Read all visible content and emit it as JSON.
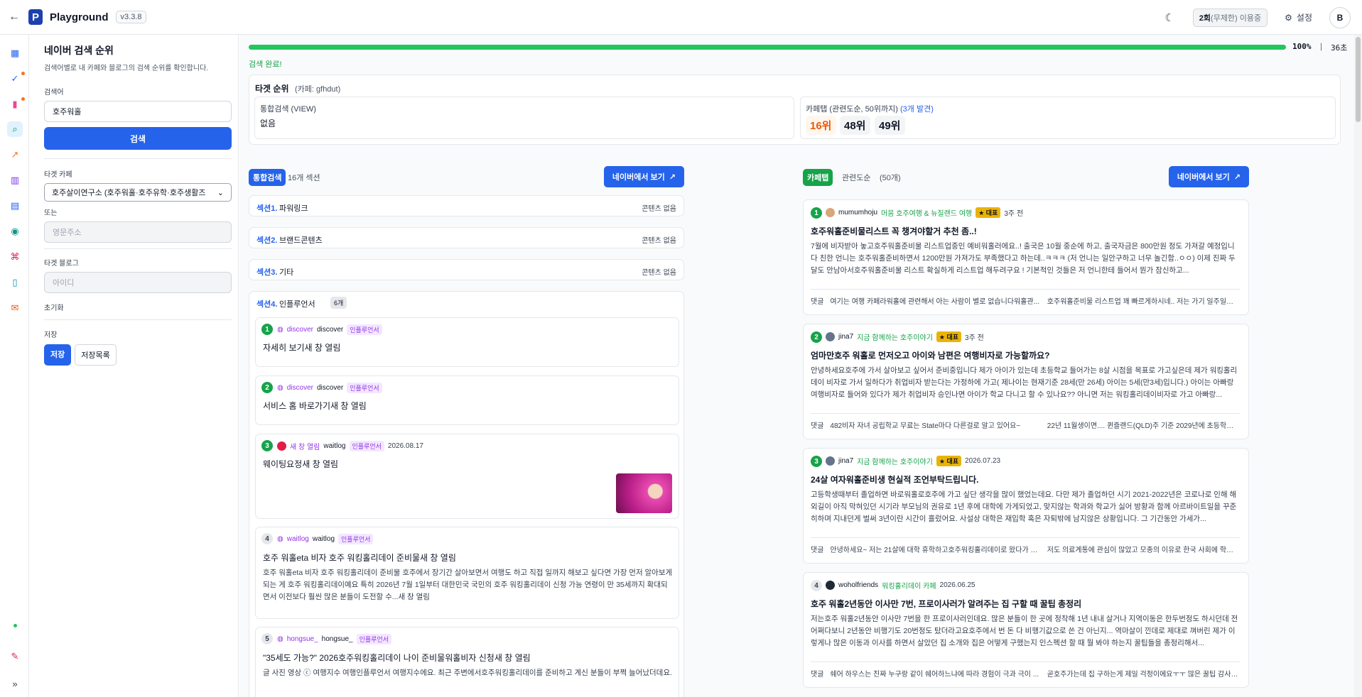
{
  "topbar": {
    "back_icon": "arrow-left-icon",
    "app_name": "Playground",
    "version": "v3.3.8",
    "usage_count": "2회",
    "usage_desc": "(무제한) 이용중",
    "settings_label": "설정",
    "avatar_letter": "B"
  },
  "left": {
    "title": "네이버 검색 순위",
    "subtitle": "검색어별로 내 카페와 블로그의 검색 순위를 확인합니다.",
    "keyword_label": "검색어",
    "keyword_value": "호주워홀",
    "search_button": "검색",
    "cafe_label": "타겟 카페",
    "cafe_value": "호주살이연구소 (호주워홀·호주유학·호주생활즈",
    "or_label": "또는",
    "cafe_id_placeholder": "영문주소",
    "blog_label": "타겟 블로그",
    "blog_placeholder": "아이디",
    "reset_label": "초기화",
    "save_label": "저장",
    "save_button": "저장",
    "save_list_button": "저장목록"
  },
  "progress": {
    "percent": 100,
    "percent_label": "100%",
    "separator": "|",
    "seconds": "36초",
    "status": "검색 완료!"
  },
  "target": {
    "title": "타겟 순위",
    "cafe": "(카페: gfhdut)",
    "view_label": "통합검색 (VIEW)",
    "view_value": "없음",
    "cafe_tab_label": "카페탭 (관련도순, 50위까지)",
    "cafe_tab_found": "(3개 발견)",
    "ranks": [
      "16위",
      "48위",
      "49위"
    ]
  },
  "integrated": {
    "pill": "통합검색",
    "count": "16개 섹션",
    "naver_button": "네이버에서 보기",
    "sections": [
      {
        "label": "섹션1.",
        "name": "파워링크",
        "status": "콘텐츠 없음"
      },
      {
        "label": "섹션2.",
        "name": "브랜드콘텐츠",
        "status": "콘텐츠 없음"
      },
      {
        "label": "섹션3.",
        "name": "기타",
        "status": "콘텐츠 없음"
      }
    ],
    "influencer": {
      "label": "섹션4.",
      "name": "인플루언서",
      "count": "6개",
      "items": [
        {
          "num": "1",
          "link": "discover",
          "author": "discover",
          "tag": "인플루언서",
          "date": "",
          "title": "자세히 보기새 창 열림",
          "desc": ""
        },
        {
          "num": "2",
          "link": "discover",
          "author": "discover",
          "tag": "인플루언서",
          "date": "",
          "title": "서비스 홈 바로가기새 창 열림",
          "desc": ""
        },
        {
          "num": "3",
          "link": "새 창 열림",
          "author": "waitlog",
          "tag": "인플루언서",
          "date": "2026.08.17",
          "title": "웨이팅요정새 창 열림",
          "desc": ""
        },
        {
          "num": "4",
          "link": "waitlog",
          "author": "waitlog",
          "tag": "인플루언서",
          "date": "",
          "title": "호주 워홀eta 비자 호주 워킹홀리데이 준비물새 창 열림",
          "desc": "호주 워홀eta 비자 호주 워킹홀리데이 준비물 호주에서 장기간 살아보면서 여행도 하고 직접 일까지 해보고 싶다면 가장 먼저 알아보게 되는 게 호주 워킹홀리데이예요 특히 2026년 7월 1일부터 대한민국 국민의 호주 워킹홀리데이 신청 가능 연령이 만 35세까지 확대되면서 이전보다 훨씬 많은 분들이 도전할 수...새 창 열림"
        },
        {
          "num": "5",
          "link": "hongsue_",
          "author": "hongsue_",
          "tag": "인플루언서",
          "date": "",
          "title": "\"35세도 가능?\" 2026호주워킹홀리데이 나이 준비물워홀비자 신청새 창 열림",
          "desc": "글 사진 영상 ⓒ 여행지수 여행인플루언서 여행지수에요. 최근 주변에서호주워킹홀리데이를 준비하고 계신 분들이 부쩍 늘어났더데요. 특히 올해부터"
        }
      ]
    }
  },
  "cafetab": {
    "pill": "카페탭",
    "sort": "관련도순",
    "count": "(50개)",
    "naver_button": "네이버에서 보기",
    "items": [
      {
        "num": "1",
        "author": "mumumhoju",
        "cafe": "머뭄 호주여행 & 뉴질랜드 여행",
        "badge": "★ 대표",
        "date": "3주 전",
        "title": "호주워홀준비물리스트 꼭 챙겨야할거 추천 좀..!",
        "desc": "7월에 비자받아 놓고호주워홀준비물 리스트업중인 예비워홀러에요..! 출국은 10월 중순에 하고, 출국자금은 800만원 정도 가져갈 예정입니다 친한 언니는 호주워홀준비하면서 1200만원 가져가도 부족했다고 하는데..ㅋㅋㅋ (저 언니는 일안구하고 너무 놀긴함..ㅇㅇ) 이제 진짜 두달도 안남아서호주워홀준비물 리스트 확실하게 리스트업 해두려구요 ! 기본적인 것들은 저 언니한테 들어서 뭔가 잠신하고...",
        "c1": "여기는 여행 카페라워홀에 관련해서 아는 사람이 별로 없습니다워홀관...",
        "c2": "호주워홀준비물 리스트업 꽤 빠르게하시네.. 저는 가기 일주일전부터 짐..."
      },
      {
        "num": "2",
        "author": "jina7",
        "cafe": "지금 함께하는 호주이야기",
        "badge": "★ 대표",
        "date": "3주 전",
        "title": "엄마만호주 워홀로 먼저오고 아이와 남편은 여행비자로 가능할까요?",
        "desc": "안녕하세요호주에 가서 살아보고 싶어서 준비중입니다 제가 아이가 있는데 초등학교 들어가는 8살 시점을 목표로 가고싶은데 제가 워킹홀리데이 비자로 가서 일하다가 취업비자 받는다는 가정하에 가고( 제나이는 현재기준 28세(만 26세) 아이는 5세(만3세)입니다.) 아이는 아빠랑 여행비자로 들어와 있다가 제가 취업비자 승인나면 아이가 학교 다니고 할 수 있나요?? 아니면 저는 워킹홀리데이비자로 가고 아빠랑...",
        "c1": "482비자 자녀 공립학교 무료는 State마다 다른걸로 알고 있어요~",
        "c2": "22년 11월생이면.... 퀸즐랜드(QLD)주 기준 2029년에 초등학교 1학년..."
      },
      {
        "num": "3",
        "author": "jina7",
        "cafe": "지금 함께하는 호주이야기",
        "badge": "★ 대표",
        "date": "2026.07.23",
        "title": "24살 여자워홀준비생 현실적 조언부탁드립니다.",
        "desc": "고등학생때부터 졸업하면 바로워홀로호주에 가고 싶단 생각을 많이 했었는데요. 다만 제가 졸업하던 시기 2021-2022년은 코로나로 인해 해외길이 아직 막혀있던 시기라 부모님의 권유로 1년 후에 대학에 가게되었고, 맞지않는 학과와 학교가 싫어 방황과 함께 아르바이트일을 꾸준히하며 지내던게 벌써 3년이란 시간이 흘렀어요. 사설상 대학은 재입학 혹은 자퇴밖에 남지않은 상황입니다. 그 기간동안 가세가...",
        "c1": "안녕하세요~ 저는 21살에 대학 휴학하고호주워킹홀리데이로 왔다가 11...",
        "c2": "저도 의료계통에 관심이 많았고 모종의 이유로 한국 사회에 학을 떼는 ..."
      },
      {
        "num": "4",
        "author": "woholfriends",
        "cafe": "워킹홀리데이 카페",
        "badge": "",
        "date": "2026.06.25",
        "title": "호주 워홀2년동안 이사만 7번, 프로이사러가 알려주는 집 구할 때 꿀팁 총정리",
        "desc": "저는호주 워홀2년동안 이사만 7번을 한 프로이사러인데요. 많은 분들이 한 곳에 정착해 1년 내내 살거나 지역이동은 한두번정도 하시던데 전 어쩌다보니 2년동안 비행기도 20번정도 탔더라고요호주에서 번 돈 다 비행기값으로 쓴 건 아닌지... 역마살이 낀데로 제대로 껴버린 제가 이렇게나 많은 이동과 이사를 하면서 살았던 집 소개와 집은 어떻게 구했는지 인스펙션 할 때 뭘 봐야 하는지 꿀팁들을 총정리해서...",
        "c1": "쉐어 하우스는 진짜 누구랑 같이 쉐어하느냐에 따라 경험이 극과 극이 ...",
        "c2": "곧호주가는데 집 구하는게 제일 걱정이에요ㅜㅜ 많은 꿀팁 감사해요!!"
      }
    ],
    "comment_label": "댓글"
  },
  "colors": {
    "accent": "#2563eb",
    "success": "#16a34a",
    "influencer": "#9333ea",
    "rank_highlight": "#ea580c"
  }
}
